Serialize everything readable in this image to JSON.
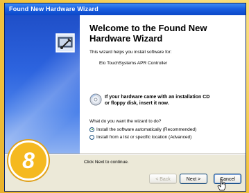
{
  "window": {
    "title": "Found New Hardware Wizard"
  },
  "content": {
    "heading": "Welcome to the Found New Hardware Wizard",
    "intro": "This wizard helps you install software for:",
    "device": "Elo TouchSystems APR Controller",
    "cd_notice_line1": "If your hardware came with an installation CD",
    "cd_notice_line2": "or floppy disk, insert it now.",
    "question": "What do you want the wizard to do?",
    "options": [
      {
        "label": "Install the software automatically (Recommended)",
        "checked": true
      },
      {
        "label": "Install from a list or specific location (Advanced)",
        "checked": false
      }
    ],
    "continue_text": "Click Next to continue."
  },
  "buttons": {
    "back": "< Back",
    "next": "Next >",
    "cancel": "Cancel"
  },
  "badge": {
    "step": "8"
  },
  "icons": {
    "wizard": "hardware-wizard-icon",
    "cd": "cd-icon",
    "cursor": "pointer-cursor-icon"
  },
  "colors": {
    "titlebar": "#1a5fe0",
    "left_panel": "#2d64df",
    "badge": "#f5b91f",
    "background": "#f4c844"
  }
}
